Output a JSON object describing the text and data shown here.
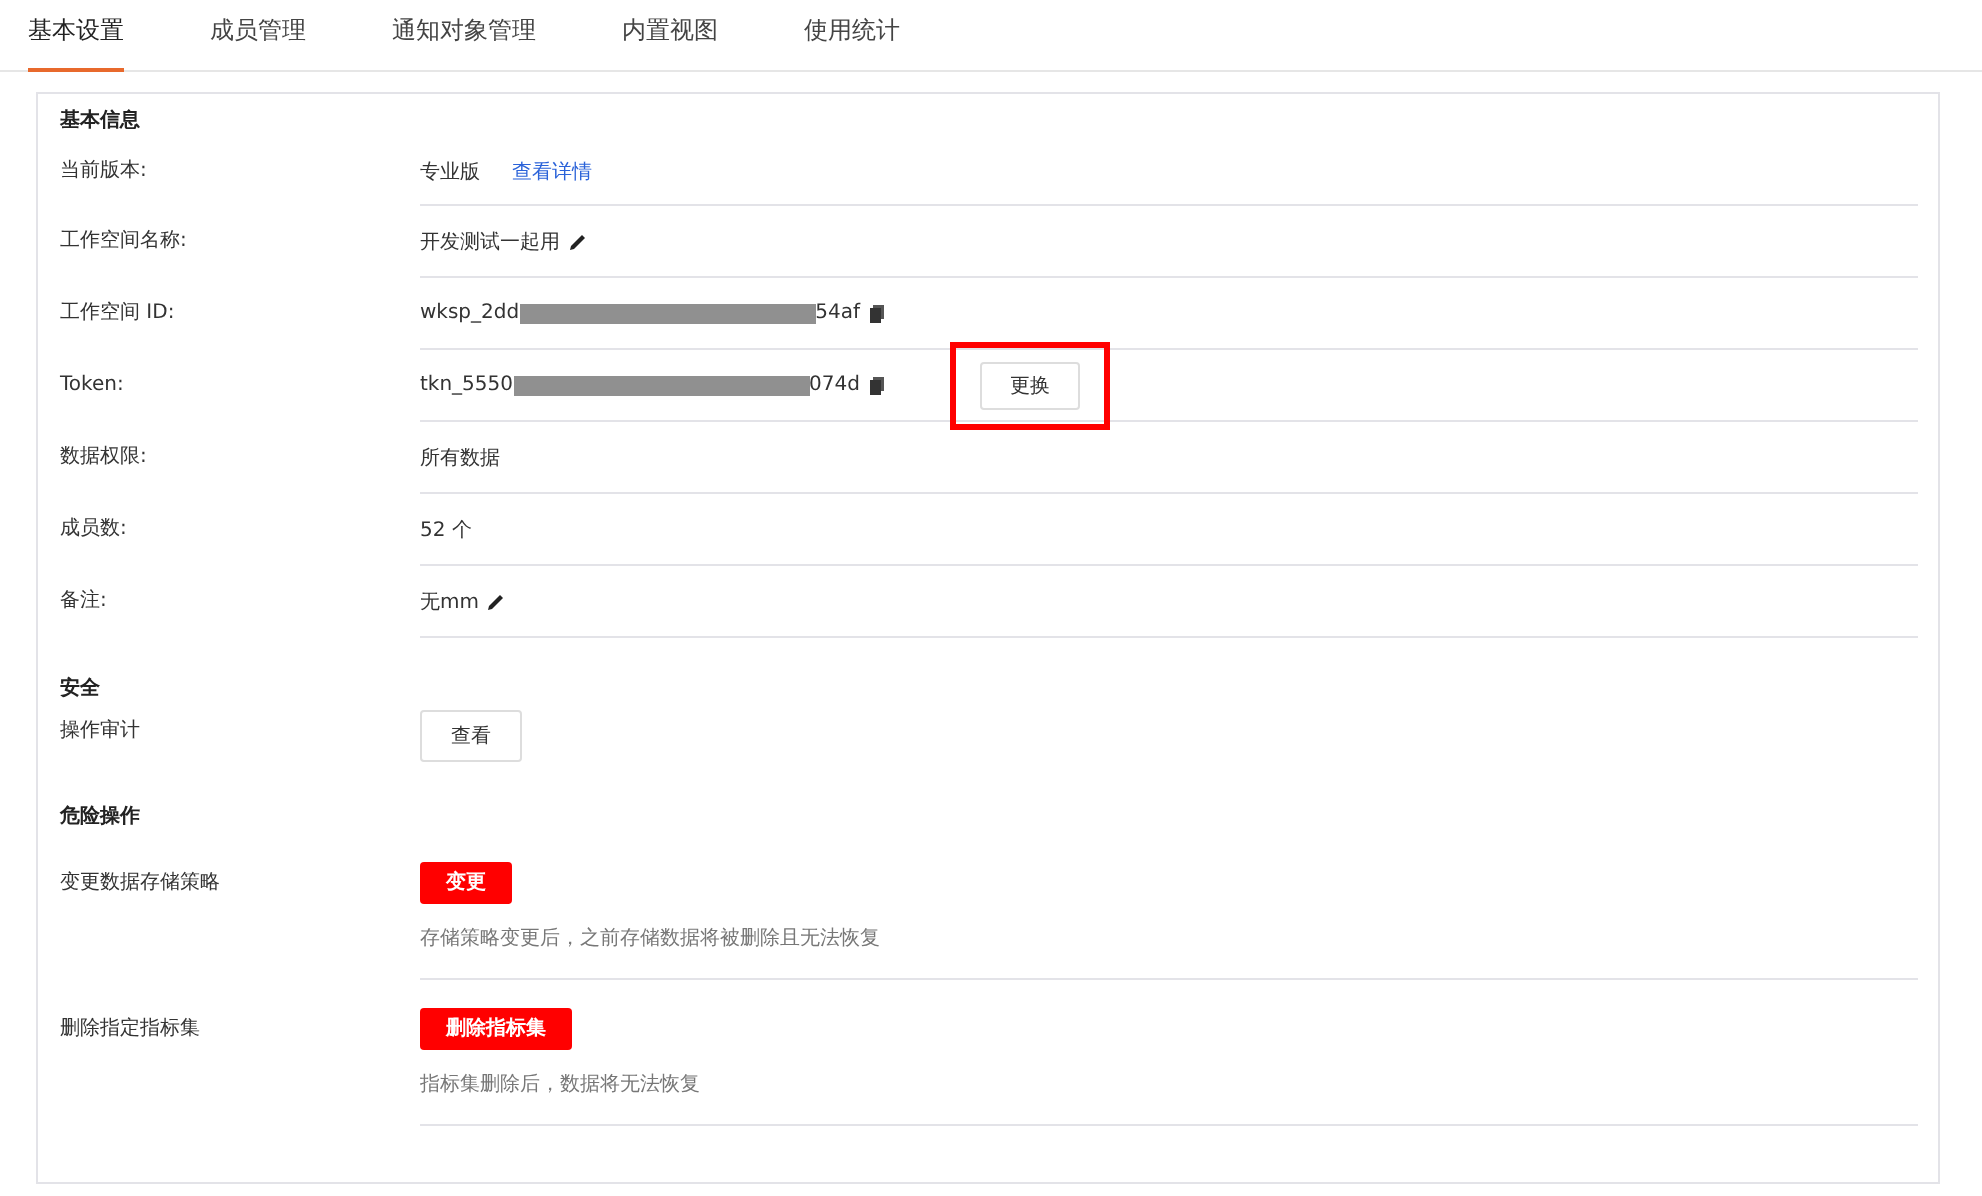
{
  "tabs": [
    {
      "label": "基本设置",
      "selected": true
    },
    {
      "label": "成员管理",
      "selected": false
    },
    {
      "label": "通知对象管理",
      "selected": false
    },
    {
      "label": "内置视图",
      "selected": false
    },
    {
      "label": "使用统计",
      "selected": false
    }
  ],
  "basic_info": {
    "title": "基本信息",
    "rows": [
      {
        "kind": "link",
        "label": "当前版本:",
        "value": "专业版",
        "link": "查看详情"
      },
      {
        "kind": "edit",
        "label": "工作空间名称:",
        "value": "开发测试一起用"
      },
      {
        "kind": "masked",
        "label": "工作空间 ID:",
        "value_start": "wksp_2dd",
        "value_end": "54af"
      },
      {
        "kind": "masked",
        "label": "Token:",
        "value_start": "tkn_5550",
        "value_end": "074d",
        "button": "更换",
        "highlighted": true
      },
      {
        "kind": "text",
        "label": "数据权限:",
        "value": "所有数据"
      },
      {
        "kind": "text",
        "label": "成员数:",
        "value": "52 个"
      },
      {
        "kind": "edit",
        "label": "备注:",
        "value": "无mm"
      }
    ]
  },
  "security": {
    "title": "安全",
    "rows": [
      {
        "label": "操作审计",
        "button": "查看"
      }
    ]
  },
  "danger": {
    "title": "危险操作",
    "rows": [
      {
        "label": "变更数据存储策略",
        "button": "变更",
        "hint": "存储策略变更后，之前存储数据将被删除且无法恢复"
      },
      {
        "label": "删除指定指标集",
        "button": "删除指标集",
        "hint": "指标集删除后，数据将无法恢复"
      }
    ]
  }
}
